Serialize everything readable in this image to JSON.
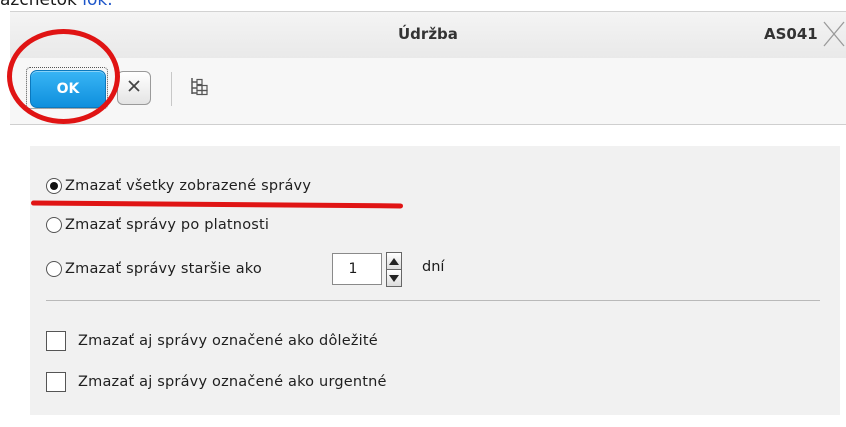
{
  "top_caption": {
    "prefix": "azčnetok",
    "link": "lok."
  },
  "window": {
    "title": "Údržba",
    "code": "AS041"
  },
  "toolbar": {
    "ok_label": "OK",
    "cancel_icon": "close-x-icon",
    "tree_icon": "tree-structure-icon"
  },
  "options": {
    "delete_mode": [
      {
        "label": "Zmazať všetky zobrazené správy",
        "checked": true
      },
      {
        "label": "Zmazať správy po platnosti",
        "checked": false
      },
      {
        "label": "Zmazať správy staršie ako",
        "checked": false
      }
    ],
    "days_value": "1",
    "days_unit": "dní",
    "also_delete": [
      {
        "label": "Zmazať aj správy označené ako dôležité",
        "checked": false
      },
      {
        "label": "Zmazať aj správy označené ako urgentné",
        "checked": false
      }
    ]
  },
  "annotation_color": "#e01414",
  "accent_color": "#1b9ce8"
}
